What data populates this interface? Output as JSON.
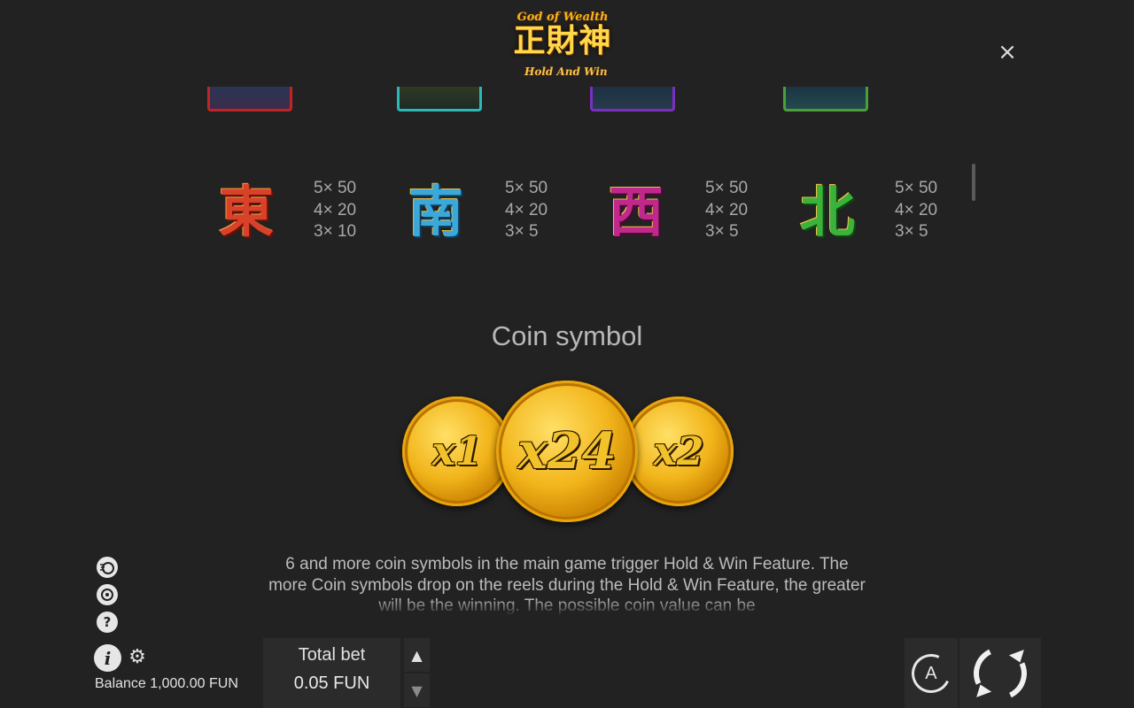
{
  "header": {
    "logo_top": "God of Wealth",
    "logo_main": "正財神",
    "logo_sub": "Hold And Win",
    "close_icon": "×"
  },
  "symbols": [
    {
      "glyph": "東",
      "pays": [
        "5× 50",
        "4× 20",
        "3× 10"
      ],
      "color": "#d8412a"
    },
    {
      "glyph": "南",
      "pays": [
        "5× 50",
        "4× 20",
        "3× 5"
      ],
      "color": "#3aa8d8"
    },
    {
      "glyph": "西",
      "pays": [
        "5× 50",
        "4× 20",
        "3× 5"
      ],
      "color": "#c0298a"
    },
    {
      "glyph": "北",
      "pays": [
        "5× 50",
        "4× 20",
        "3× 5"
      ],
      "color": "#3bb23b"
    }
  ],
  "coin_section": {
    "title": "Coin symbol",
    "coins": [
      "x1",
      "x24",
      "x2"
    ],
    "description": "6 and more coin symbols in the main game trigger Hold & Win Feature. The more Coin symbols drop on the reels during the Hold & Win Feature, the greater will be the winning. The possible coin value can be"
  },
  "footer": {
    "balance": "Balance 1,000.00 FUN",
    "total_bet_label": "Total bet",
    "total_bet_value": "0.05 FUN",
    "auto_label": "A",
    "bet_up_icon": "▲",
    "bet_down_icon": "▼",
    "info_icon": "i",
    "help_icon": "?",
    "gear_icon": "⚙"
  },
  "colors": {
    "background": "#222222",
    "panel": "#2b2b2b",
    "coin_gold": "#f2b51b"
  }
}
